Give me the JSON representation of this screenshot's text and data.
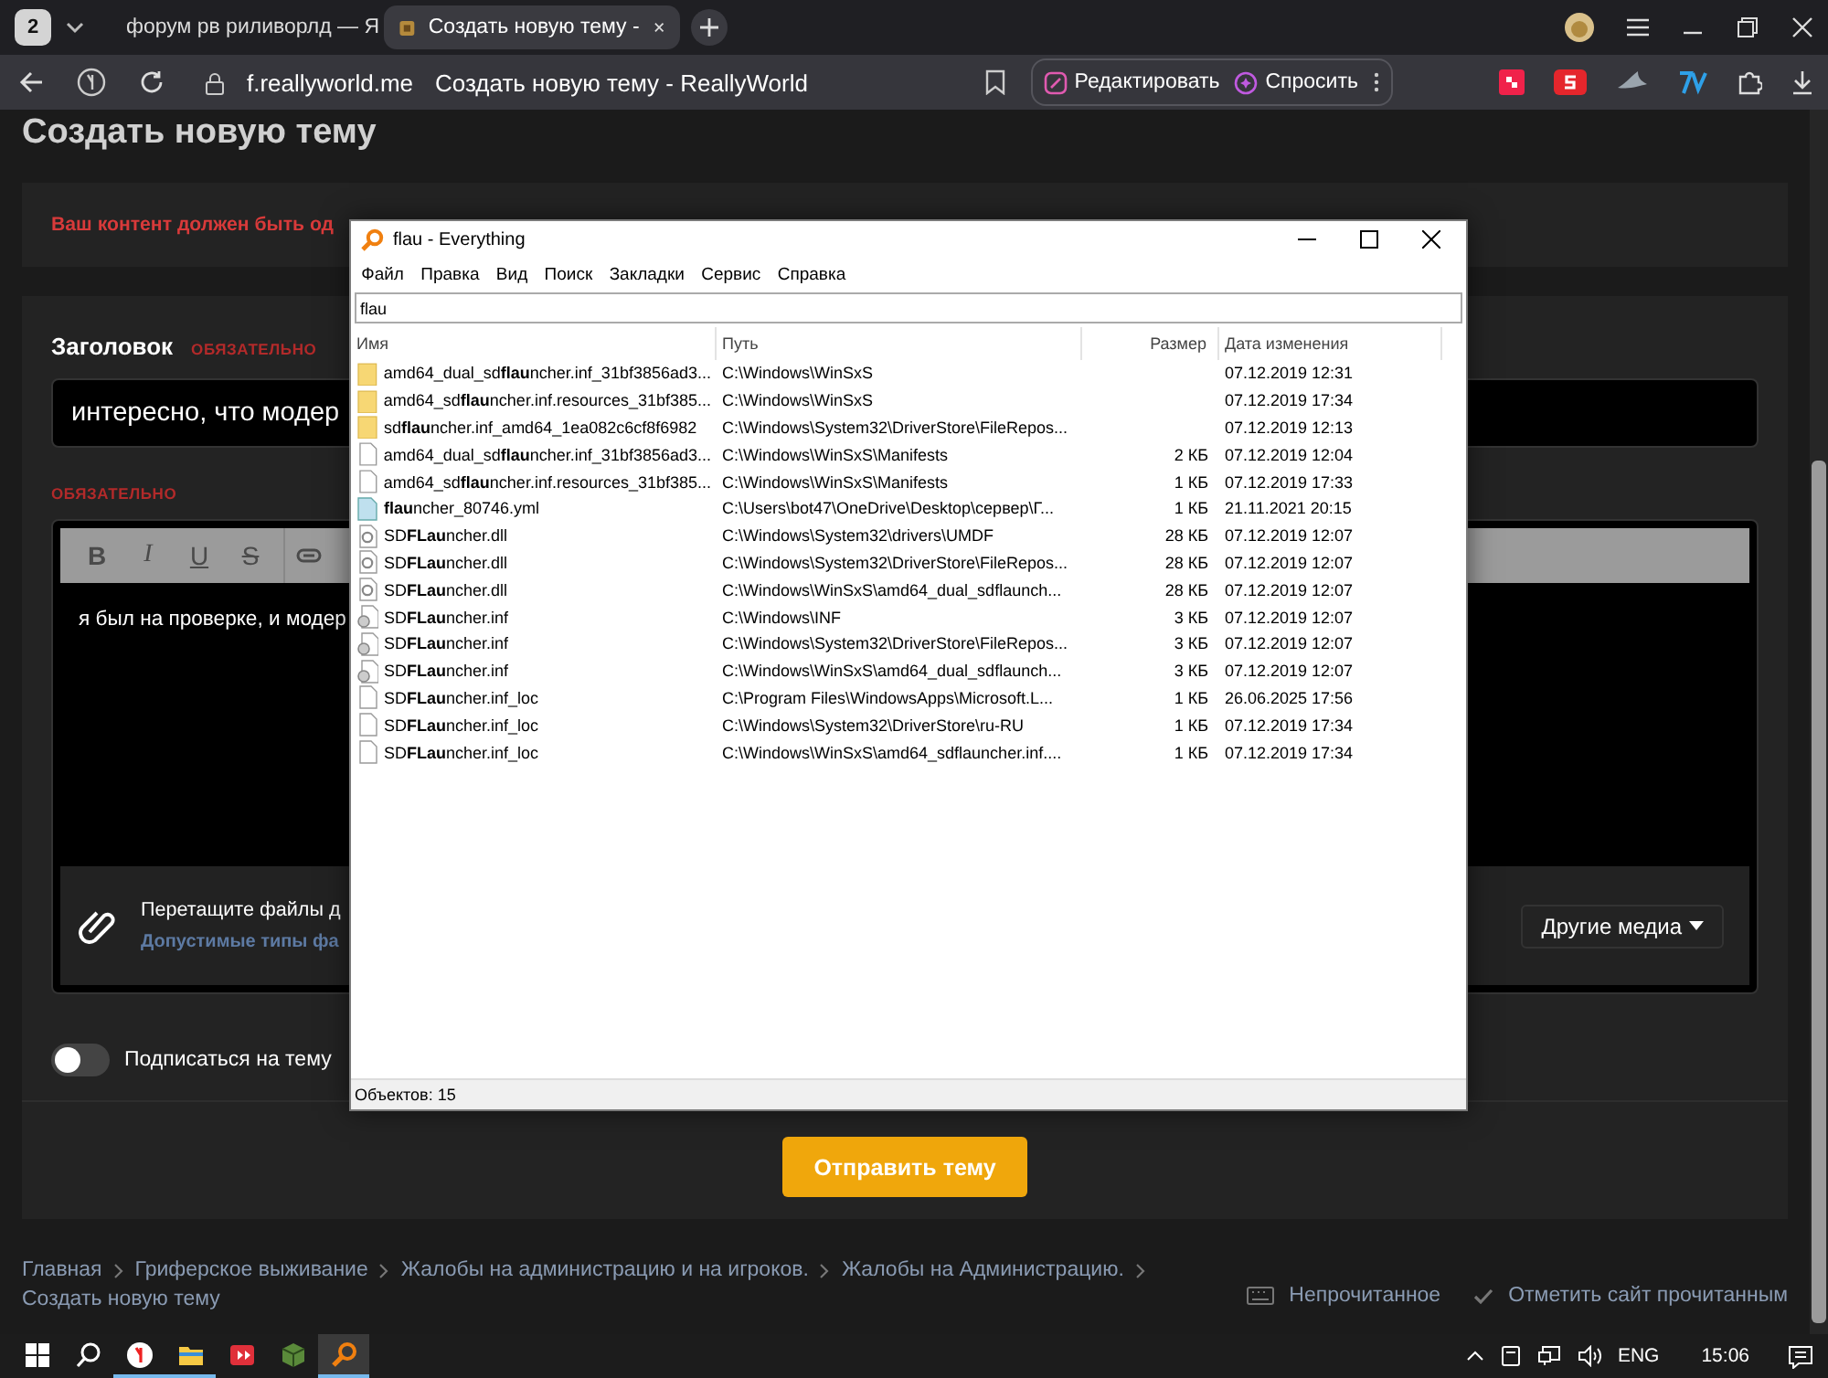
{
  "browser": {
    "tab_count": "2",
    "tabs": [
      {
        "title": "форум рв риливорлд — Я",
        "kind": "search",
        "selected": false
      },
      {
        "title": "Создать новую тему -",
        "kind": "site",
        "selected": true
      }
    ],
    "address": {
      "domain": "f.reallyworld.me",
      "page_title": "Создать новую тему - ReallyWorld"
    },
    "actions": [
      {
        "kind": "edit",
        "label": "Редактировать"
      },
      {
        "kind": "ask",
        "label": "Спросить"
      }
    ]
  },
  "page": {
    "heading": "Создать новую тему",
    "error": "Ваш контент должен быть од",
    "title_field": {
      "label": "Заголовок",
      "required": "ОБЯЗАТЕЛЬНО",
      "value": "интересно, что модер"
    },
    "message_field": {
      "required": "ОБЯЗАТЕЛЬНО",
      "toolbar": [
        {
          "kind": "bold",
          "label": "B"
        },
        {
          "kind": "italic",
          "label": "I"
        },
        {
          "kind": "underline",
          "label": "U"
        },
        {
          "kind": "strike",
          "label": "S"
        },
        {
          "kind": "link"
        }
      ],
      "value": "я был на проверке, и модер",
      "attach_hint": "Перетащите файлы д",
      "allowed_types": "Допустимые типы фа",
      "media_button": "Другие медиа"
    },
    "subscribe": {
      "label": "Подписаться на тему",
      "on": false
    },
    "submit": "Отправить тему"
  },
  "breadcrumbs": [
    "Главная",
    "Гриферское выживание",
    "Жалобы на администрацию и на игроков.",
    "Жалобы на Администрацию.",
    "Создать новую тему"
  ],
  "footer_links": [
    {
      "kind": "unread",
      "label": "Непрочитанное"
    },
    {
      "kind": "mark_read",
      "label": "Отметить сайт прочитанным"
    }
  ],
  "everything": {
    "title": "flau - Everything",
    "menu": [
      "Файл",
      "Правка",
      "Вид",
      "Поиск",
      "Закладки",
      "Сервис",
      "Справка"
    ],
    "search": "flau",
    "columns": [
      "Имя",
      "Путь",
      "Размер",
      "Дата изменения"
    ],
    "rows": [
      {
        "kind": "folder",
        "name": "amd64_dual_sd**flau**ncher.inf_31bf3856ad3...",
        "path": "C:\\Windows\\WinSxS",
        "date": "07.12.2019 12:31"
      },
      {
        "kind": "folder",
        "name": "amd64_sd**flau**ncher.inf.resources_31bf385...",
        "path": "C:\\Windows\\WinSxS",
        "date": "07.12.2019 17:34"
      },
      {
        "kind": "folder",
        "name": "sd**flau**ncher.inf_amd64_1ea082c6cf8f6982",
        "path": "C:\\Windows\\System32\\DriverStore\\FileRepos...",
        "date": "07.12.2019 12:13"
      },
      {
        "kind": "file",
        "name": "amd64_dual_sd**flau**ncher.inf_31bf3856ad3...",
        "path": "C:\\Windows\\WinSxS\\Manifests",
        "size": "2 КБ",
        "date": "07.12.2019 12:04"
      },
      {
        "kind": "file",
        "name": "amd64_sd**flau**ncher.inf.resources_31bf385...",
        "path": "C:\\Windows\\WinSxS\\Manifests",
        "size": "1 КБ",
        "date": "07.12.2019 17:33"
      },
      {
        "kind": "config",
        "name": "**flau**ncher_80746.yml",
        "path": "C:\\Users\\bot47\\OneDrive\\Desktop\\сервер\\Г...",
        "size": "1 КБ",
        "date": "21.11.2021 20:15"
      },
      {
        "kind": "library",
        "name": "SD**FLau**ncher.dll",
        "path": "C:\\Windows\\System32\\drivers\\UMDF",
        "size": "28 КБ",
        "date": "07.12.2019 12:07"
      },
      {
        "kind": "library",
        "name": "SD**FLau**ncher.dll",
        "path": "C:\\Windows\\System32\\DriverStore\\FileRepos...",
        "size": "28 КБ",
        "date": "07.12.2019 12:07"
      },
      {
        "kind": "library",
        "name": "SD**FLau**ncher.dll",
        "path": "C:\\Windows\\WinSxS\\amd64_dual_sdflaunch...",
        "size": "28 КБ",
        "date": "07.12.2019 12:07"
      },
      {
        "kind": "setup",
        "name": "SD**FLau**ncher.inf",
        "path": "C:\\Windows\\INF",
        "size": "3 КБ",
        "date": "07.12.2019 12:07"
      },
      {
        "kind": "setup",
        "name": "SD**FLau**ncher.inf",
        "path": "C:\\Windows\\System32\\DriverStore\\FileRepos...",
        "size": "3 КБ",
        "date": "07.12.2019 12:07"
      },
      {
        "kind": "setup",
        "name": "SD**FLau**ncher.inf",
        "path": "C:\\Windows\\WinSxS\\amd64_dual_sdflaunch...",
        "size": "3 КБ",
        "date": "07.12.2019 12:07"
      },
      {
        "kind": "file",
        "name": "SD**FLau**ncher.inf_loc",
        "path": "C:\\Program Files\\WindowsApps\\Microsoft.L...",
        "size": "1 КБ",
        "date": "26.06.2025 17:56"
      },
      {
        "kind": "file",
        "name": "SD**FLau**ncher.inf_loc",
        "path": "C:\\Windows\\System32\\DriverStore\\ru-RU",
        "size": "1 КБ",
        "date": "07.12.2019 17:34"
      },
      {
        "kind": "file",
        "name": "SD**FLau**ncher.inf_loc",
        "path": "C:\\Windows\\WinSxS\\amd64_sdflauncher.inf....",
        "size": "1 КБ",
        "date": "07.12.2019 17:34"
      }
    ],
    "status": "Объектов: 15"
  },
  "taskbar": {
    "apps": [
      {
        "kind": "start",
        "selected": false,
        "running": false
      },
      {
        "kind": "search",
        "selected": false,
        "running": false
      },
      {
        "kind": "browser",
        "selected": false,
        "running": true
      },
      {
        "kind": "explorer",
        "selected": false,
        "running": true
      },
      {
        "kind": "recorder",
        "selected": false,
        "running": false
      },
      {
        "kind": "cube",
        "selected": false,
        "running": false
      },
      {
        "kind": "everything",
        "selected": true,
        "running": true
      }
    ],
    "language": "ENG",
    "time": "15:06"
  }
}
